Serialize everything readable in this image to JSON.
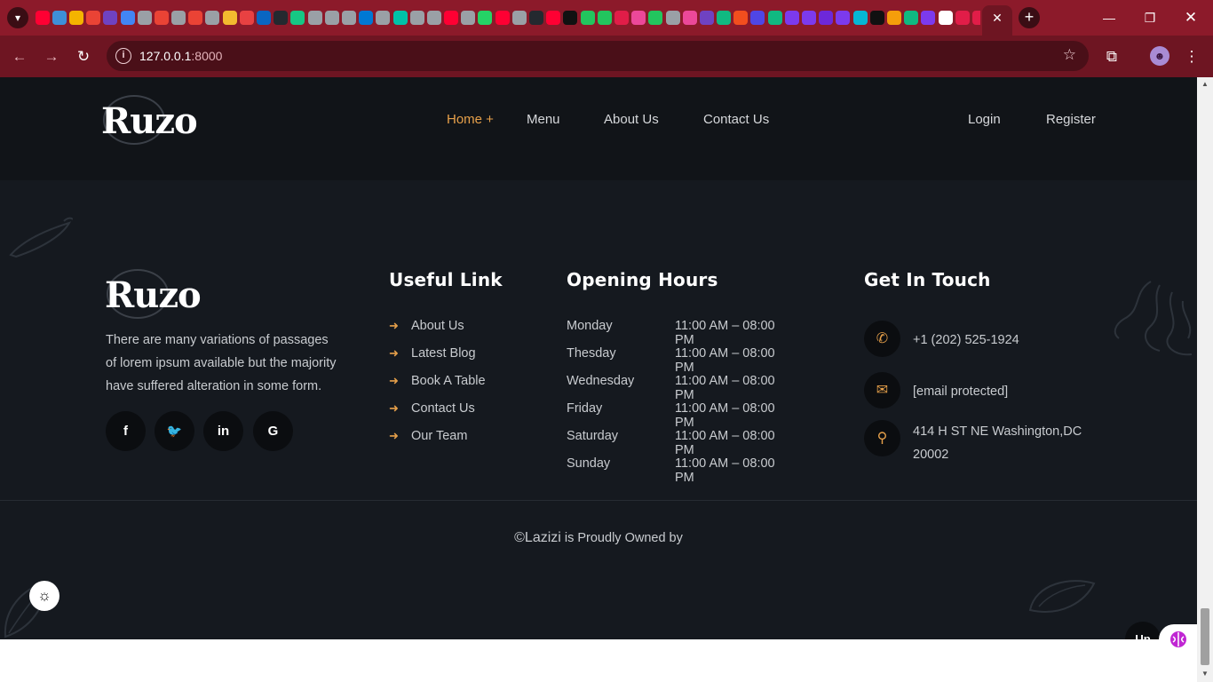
{
  "browser": {
    "url_host": "127.0.0.1",
    "url_port": ":8000",
    "tab_favicons": [
      "#ff0033",
      "#3e8fd8",
      "#f4b400",
      "#ea4335",
      "#6f42c1",
      "#4285f4",
      "#9aa0a6",
      "#ea4335",
      "#9aa0a6",
      "#ea4335",
      "#9aa0a6",
      "#f3ba2f",
      "#e84142",
      "#0a66c2",
      "#24292f",
      "#16c784",
      "#9aa0a6",
      "#9aa0a6",
      "#9aa0a6",
      "#0078d4",
      "#9aa0a6",
      "#00c2a8",
      "#9aa0a6",
      "#9aa0a6",
      "#ff0033",
      "#9aa0a6",
      "#25d366",
      "#ff0033",
      "#9aa0a6",
      "#24292f",
      "#ff0033",
      "#111111",
      "#22c55e",
      "#22c55e",
      "#e11d48",
      "#ec4899",
      "#22c55e",
      "#9aa0a6",
      "#ec4899",
      "#6f42c1",
      "#10b981",
      "#f24e1e",
      "#4f46e5",
      "#10b981",
      "#7c3aed",
      "#7c3aed",
      "#6d28d9",
      "#7c3aed",
      "#06b6d4",
      "#111111",
      "#f59e0b",
      "#10b981",
      "#7c3aed",
      "#ffffff",
      "#e11d48",
      "#e11d48"
    ]
  },
  "header": {
    "logo": "Ruzo",
    "nav": [
      {
        "label": "Home +",
        "active": true
      },
      {
        "label": "Menu",
        "active": false
      },
      {
        "label": "About Us",
        "active": false
      },
      {
        "label": "Contact Us",
        "active": false
      }
    ],
    "login": "Login",
    "register": "Register"
  },
  "footer": {
    "logo": "Ruzo",
    "about": "There are many variations of passages of lorem ipsum available but the majority have suffered alteration in some form.",
    "social": [
      {
        "icon": "facebook-icon",
        "glyph": "f"
      },
      {
        "icon": "twitter-icon",
        "glyph": "🐦"
      },
      {
        "icon": "linkedin-icon",
        "glyph": "in"
      },
      {
        "icon": "google-icon",
        "glyph": "G"
      }
    ],
    "useful_title": "Useful Link",
    "useful_links": [
      "About Us",
      "Latest Blog",
      "Book A Table",
      "Contact Us",
      "Our Team"
    ],
    "hours_title": "Opening Hours",
    "hours": [
      {
        "day": "Monday",
        "time": "11:00 AM – 08:00 PM"
      },
      {
        "day": "Thesday",
        "time": "11:00 AM – 08:00 PM"
      },
      {
        "day": "Wednesday",
        "time": "11:00 AM – 08:00 PM"
      },
      {
        "day": "Friday",
        "time": "11:00 AM – 08:00 PM"
      },
      {
        "day": "Saturday",
        "time": "11:00 AM – 08:00 PM"
      },
      {
        "day": "Sunday",
        "time": "11:00 AM – 08:00 PM"
      }
    ],
    "contact_title": "Get In Touch",
    "phone": "+1 (202) 525-1924",
    "email": "[email protected]",
    "address": "414 H ST NE Washington,DC 20002",
    "copyright_brand": "©Lazizi",
    "copyright_text": " is Proudly Owned by"
  },
  "up_label": "Up",
  "accent_color": "#e6a04a"
}
